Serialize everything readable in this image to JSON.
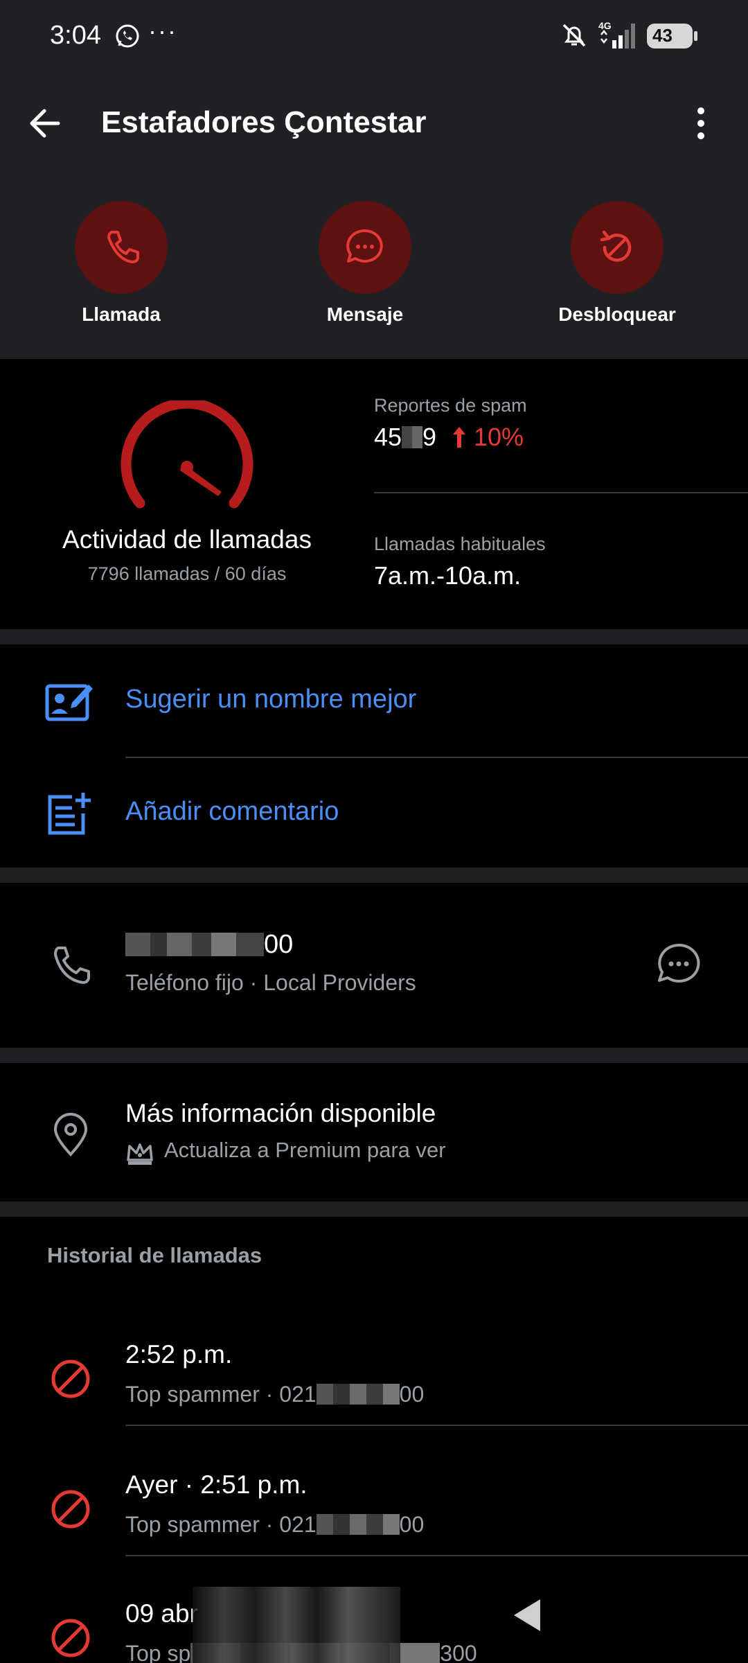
{
  "status_bar": {
    "time": "3:04",
    "dots": "···",
    "network": "4G",
    "battery": "43"
  },
  "header": {
    "title": "Estafadores Çontestar"
  },
  "actions": [
    {
      "label": "Llamada",
      "icon": "phone-icon"
    },
    {
      "label": "Mensaje",
      "icon": "message-icon"
    },
    {
      "label": "Desbloquear",
      "icon": "unblock-icon"
    }
  ],
  "stats": {
    "activity_title": "Actividad de llamadas",
    "activity_sub": "7796 llamadas / 60 días",
    "spam_label": "Reportes de spam",
    "spam_value_start": "45",
    "spam_value_end": "9",
    "spam_trend": "10%",
    "hours_label": "Llamadas habituales",
    "hours_value": "7a.m.-10a.m."
  },
  "links": {
    "suggest": "Sugerir un nombre mejor",
    "comment": "Añadir comentario"
  },
  "phone": {
    "number_suffix": "00",
    "sub": "Teléfono fijo · Local Providers"
  },
  "info": {
    "title": "Más información disponible",
    "sub": "Actualiza a Premium para ver"
  },
  "history": {
    "title": "Historial de llamadas",
    "items": [
      {
        "time": "2:52 p.m.",
        "sub_prefix": "Top spammer · 021",
        "sub_suffix": "00"
      },
      {
        "time": "Ayer · 2:51 p.m.",
        "sub_prefix": "Top spammer · 021",
        "sub_suffix": "00"
      },
      {
        "time": "09 abr",
        "sub_prefix": "Top sp",
        "sub_suffix": "300"
      }
    ]
  },
  "colors": {
    "accent_blue": "#4a8ff6",
    "danger_red": "#e53935",
    "action_circle": "#5e1111",
    "header_bg": "#202124"
  }
}
